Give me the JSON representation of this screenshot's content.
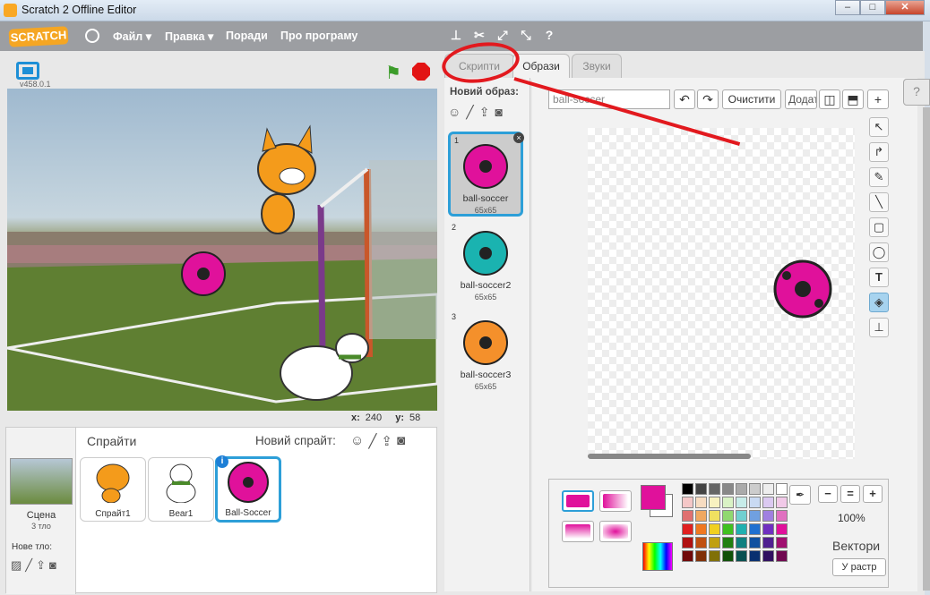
{
  "window": {
    "title": "Scratch 2 Offline Editor"
  },
  "menu": {
    "items": [
      "Файл",
      "Правка",
      "Поради",
      "Про програму"
    ],
    "logo": "SCRATCH"
  },
  "stage": {
    "version": "v458.0.1",
    "x_label": "x:",
    "x_value": "240",
    "y_label": "y:",
    "y_value": "58"
  },
  "sprites_panel": {
    "title": "Спрайти",
    "new_sprite_label": "Новий спрайт:",
    "scene": {
      "name": "Сцена",
      "count": "3 тло"
    },
    "new_backdrop_label": "Нове тло:",
    "sprites": [
      {
        "name": "Спрайт1",
        "selected": false
      },
      {
        "name": "Bear1",
        "selected": false
      },
      {
        "name": "Ball-Soccer",
        "selected": true
      }
    ]
  },
  "tabs": [
    "Скрипти",
    "Образи",
    "Звуки"
  ],
  "active_tab": "Образи",
  "costumes": {
    "new_label": "Новий образ:",
    "items": [
      {
        "num": "1",
        "name": "ball-soccer",
        "size": "65x65",
        "color": "#e0119b"
      },
      {
        "num": "2",
        "name": "ball-soccer2",
        "size": "65x65",
        "color": "#1ab3b0"
      },
      {
        "num": "3",
        "name": "ball-soccer3",
        "size": "65x65",
        "color": "#f4902b"
      }
    ]
  },
  "editor": {
    "costume_name": "ball-soccer",
    "clear_label": "Очистити",
    "add_label": "Додати",
    "zoom_level": "100%",
    "mode_label": "Вектори",
    "bitmap_button": "У растр"
  },
  "colors": {
    "accent": "#2d9fd8",
    "primary": "#e0119b",
    "annotation": "#e2191e"
  }
}
